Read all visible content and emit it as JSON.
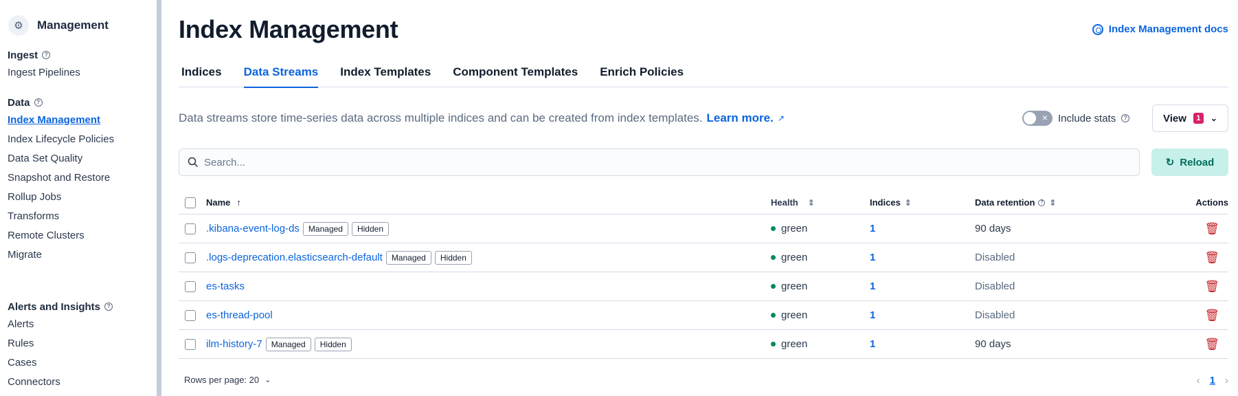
{
  "sidebar": {
    "title": "Management",
    "title_icon": "gear-icon",
    "groups": [
      {
        "heading": "Ingest",
        "items": [
          "Ingest Pipelines"
        ]
      },
      {
        "heading": "Data",
        "items": [
          "Index Management",
          "Index Lifecycle Policies",
          "Data Set Quality",
          "Snapshot and Restore",
          "Rollup Jobs",
          "Transforms",
          "Remote Clusters",
          "Migrate"
        ]
      },
      {
        "heading": "Alerts and Insights",
        "items": [
          "Alerts",
          "Rules",
          "Cases",
          "Connectors"
        ]
      }
    ],
    "active_item": "Index Management"
  },
  "header": {
    "title": "Index Management",
    "docs_link": "Index Management docs"
  },
  "tabs": [
    "Indices",
    "Data Streams",
    "Index Templates",
    "Component Templates",
    "Enrich Policies"
  ],
  "active_tab": "Data Streams",
  "description": {
    "text": "Data streams store time-series data across multiple indices and can be created from index templates.",
    "link": "Learn more."
  },
  "controls": {
    "include_stats_label": "Include stats",
    "include_stats_on": false,
    "view_label": "View",
    "view_count": "1",
    "search_placeholder": "Search...",
    "reload_label": "Reload"
  },
  "table": {
    "columns": {
      "name": "Name",
      "health": "Health",
      "indices": "Indices",
      "retention": "Data retention",
      "actions": "Actions"
    },
    "rows": [
      {
        "name": ".kibana-event-log-ds",
        "tags": [
          "Managed",
          "Hidden"
        ],
        "health": "green",
        "indices": "1",
        "retention": "90 days"
      },
      {
        "name": ".logs-deprecation.elasticsearch-default",
        "tags": [
          "Managed",
          "Hidden"
        ],
        "health": "green",
        "indices": "1",
        "retention": "Disabled"
      },
      {
        "name": "es-tasks",
        "tags": [],
        "health": "green",
        "indices": "1",
        "retention": "Disabled"
      },
      {
        "name": "es-thread-pool",
        "tags": [],
        "health": "green",
        "indices": "1",
        "retention": "Disabled"
      },
      {
        "name": "ilm-history-7",
        "tags": [
          "Managed",
          "Hidden"
        ],
        "health": "green",
        "indices": "1",
        "retention": "90 days"
      }
    ]
  },
  "footer": {
    "rows_per_page": "Rows per page: 20",
    "current_page": "1"
  },
  "colors": {
    "accent": "#0b64dd",
    "health_green": "#008a5e",
    "danger": "#c61e25",
    "badge": "#d6226a",
    "reload_bg": "#c8f0ea"
  }
}
